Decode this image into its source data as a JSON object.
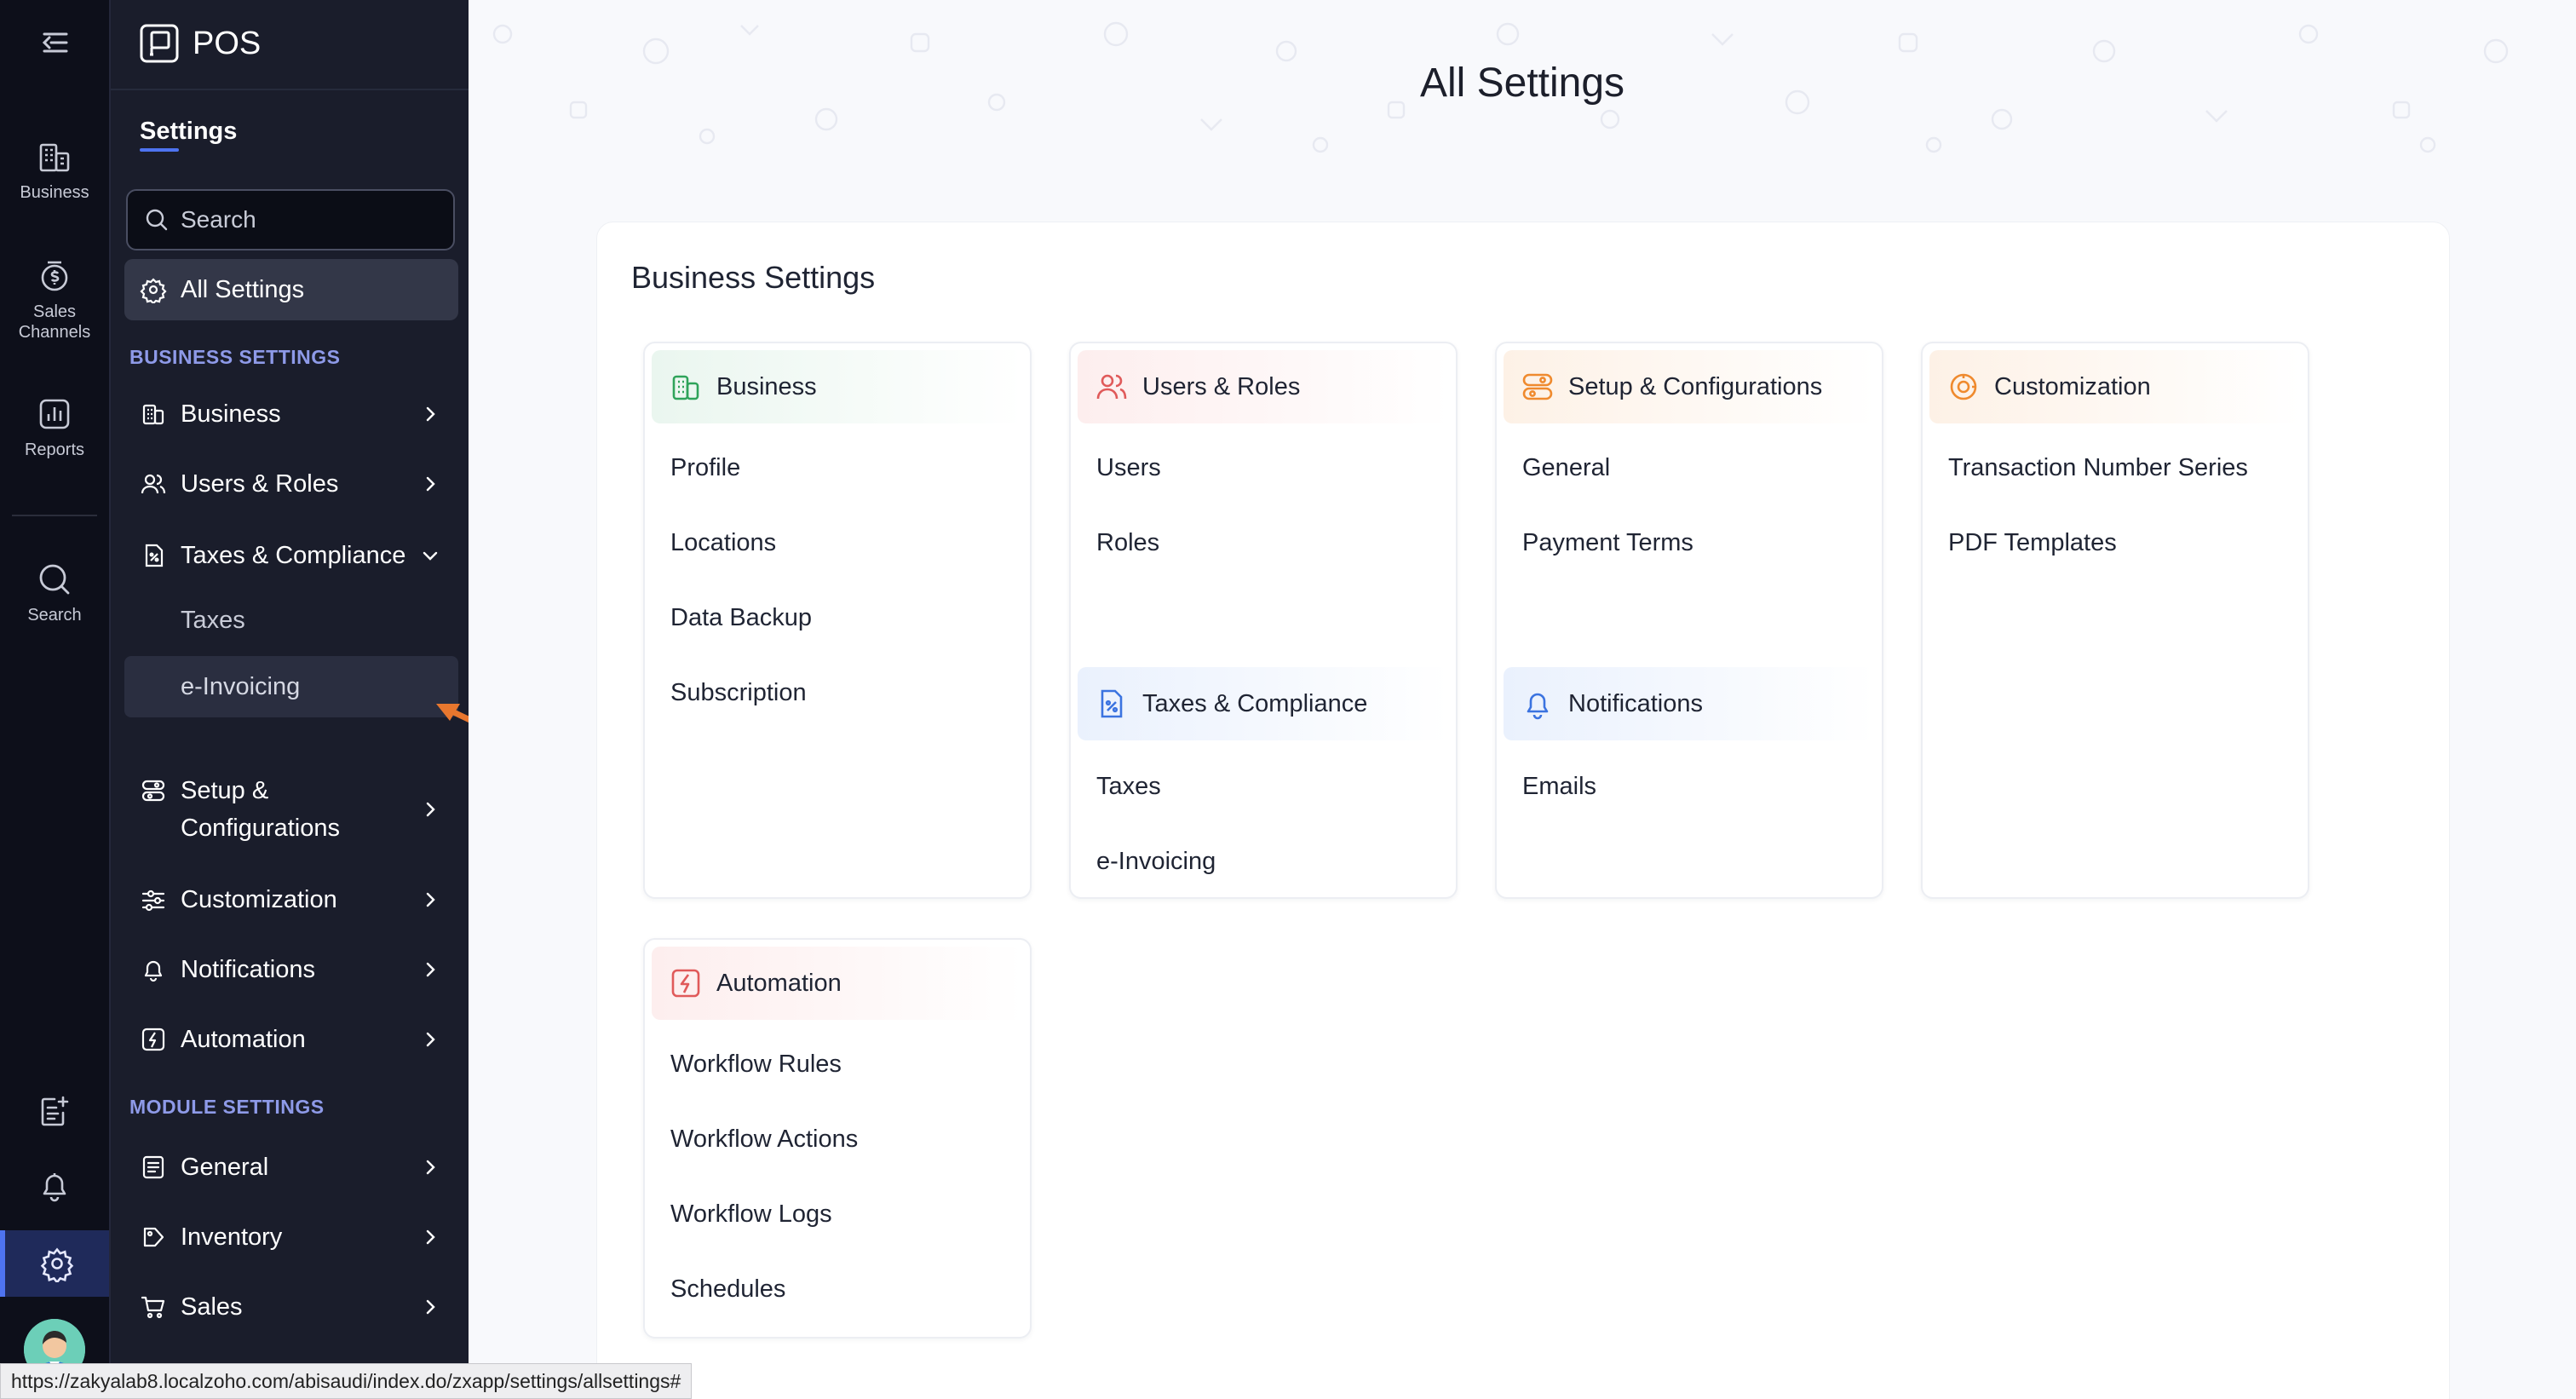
{
  "rail": {
    "items": [
      {
        "label": "Business",
        "icon": "building-icon"
      },
      {
        "label": "Sales Channels",
        "icon": "sales-channels-icon"
      },
      {
        "label": "Reports",
        "icon": "reports-icon"
      },
      {
        "label": "Search",
        "icon": "search-icon"
      }
    ],
    "bottom_icons": [
      "notes-icon",
      "bell-icon",
      "gear-icon",
      "avatar"
    ]
  },
  "sidebar": {
    "app_name": "POS",
    "title": "Settings",
    "search_placeholder": "Search",
    "all_settings_label": "All Settings",
    "business_section": "BUSINESS SETTINGS",
    "items": [
      {
        "label": "Business"
      },
      {
        "label": "Users & Roles"
      },
      {
        "label": "Taxes & Compliance",
        "sub": [
          "Taxes",
          "e-Invoicing"
        ]
      },
      {
        "label": "Setup & Configurations"
      },
      {
        "label": "Customization"
      },
      {
        "label": "Notifications"
      },
      {
        "label": "Automation"
      }
    ],
    "module_section": "MODULE SETTINGS",
    "module_items": [
      {
        "label": "General"
      },
      {
        "label": "Inventory"
      },
      {
        "label": "Sales"
      }
    ]
  },
  "main": {
    "title": "All Settings",
    "section_title": "Business Settings",
    "cards": {
      "business": {
        "title": "Business",
        "links": [
          "Profile",
          "Locations",
          "Data Backup",
          "Subscription"
        ]
      },
      "users": {
        "title": "Users & Roles",
        "links": [
          "Users",
          "Roles"
        ]
      },
      "taxes": {
        "title": "Taxes & Compliance",
        "links": [
          "Taxes",
          "e-Invoicing"
        ]
      },
      "setup": {
        "title": "Setup & Configurations",
        "links": [
          "General",
          "Payment Terms"
        ]
      },
      "notifications": {
        "title": "Notifications",
        "links": [
          "Emails"
        ]
      },
      "customization": {
        "title": "Customization",
        "links": [
          "Transaction Number Series",
          "PDF Templates"
        ]
      },
      "automation": {
        "title": "Automation",
        "links": [
          "Workflow Rules",
          "Workflow Actions",
          "Workflow Logs",
          "Schedules"
        ]
      }
    }
  },
  "status_url": "https://zakyalab8.localzoho.com/abisaudi/index.do/zxapp/settings/allsettings#",
  "colors": {
    "rail_bg": "#0d0f1a",
    "sidebar_bg": "#1a1d2b",
    "accent": "#4e73f0",
    "section_label": "#8e9ae8",
    "arrow": "#e8772e"
  }
}
